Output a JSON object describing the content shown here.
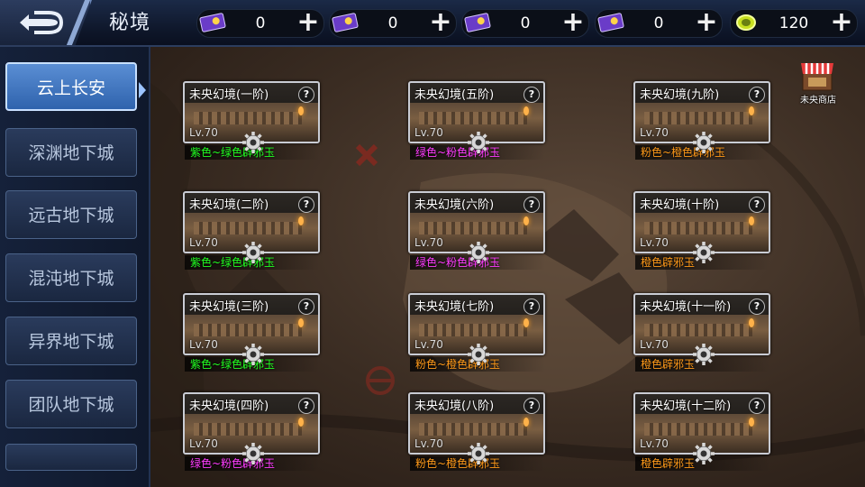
{
  "header": {
    "title": "秘境",
    "currencies": [
      {
        "icon": "purple-ticket-icon",
        "amount": "0"
      },
      {
        "icon": "purple-ticket-icon",
        "amount": "0"
      },
      {
        "icon": "purple-ticket-icon",
        "amount": "0"
      },
      {
        "icon": "purple-ticket-icon",
        "amount": "0"
      },
      {
        "icon": "green-coin-icon",
        "amount": "120"
      }
    ],
    "plus_label": "+"
  },
  "sidebar": {
    "items": [
      {
        "label": "云上长安",
        "active": true
      },
      {
        "label": "深渊地下城"
      },
      {
        "label": "远古地下城"
      },
      {
        "label": "混沌地下城"
      },
      {
        "label": "异界地下城"
      },
      {
        "label": "团队地下城"
      }
    ]
  },
  "shop": {
    "label": "未央商店",
    "icon": "shop-icon"
  },
  "dungeons": [
    {
      "name": "未央幻境(一阶)",
      "level": "Lv.70",
      "drop": "紫色~绿色辟邪玉",
      "drop_color": "#22ff22"
    },
    {
      "name": "未央幻境(二阶)",
      "level": "Lv.70",
      "drop": "紫色~绿色辟邪玉",
      "drop_color": "#22ff22"
    },
    {
      "name": "未央幻境(三阶)",
      "level": "Lv.70",
      "drop": "紫色~绿色辟邪玉",
      "drop_color": "#22ff22"
    },
    {
      "name": "未央幻境(四阶)",
      "level": "Lv.70",
      "drop": "绿色~粉色辟邪玉",
      "drop_color": "#ff3cff"
    },
    {
      "name": "未央幻境(五阶)",
      "level": "Lv.70",
      "drop": "绿色~粉色辟邪玉",
      "drop_color": "#ff3cff"
    },
    {
      "name": "未央幻境(六阶)",
      "level": "Lv.70",
      "drop": "绿色~粉色辟邪玉",
      "drop_color": "#ff3cff"
    },
    {
      "name": "未央幻境(七阶)",
      "level": "Lv.70",
      "drop": "粉色~橙色辟邪玉",
      "drop_color": "#ff9a1a"
    },
    {
      "name": "未央幻境(八阶)",
      "level": "Lv.70",
      "drop": "粉色~橙色辟邪玉",
      "drop_color": "#ff9a1a"
    },
    {
      "name": "未央幻境(九阶)",
      "level": "Lv.70",
      "drop": "粉色~橙色辟邪玉",
      "drop_color": "#ff9a1a"
    },
    {
      "name": "未央幻境(十阶)",
      "level": "Lv.70",
      "drop": "橙色辟邪玉",
      "drop_color": "#ff9a1a"
    },
    {
      "name": "未央幻境(十一阶)",
      "level": "Lv.70",
      "drop": "橙色辟邪玉",
      "drop_color": "#ff9a1a"
    },
    {
      "name": "未央幻境(十二阶)",
      "level": "Lv.70",
      "drop": "橙色辟邪玉",
      "drop_color": "#ff9a1a"
    }
  ],
  "help_label": "?"
}
